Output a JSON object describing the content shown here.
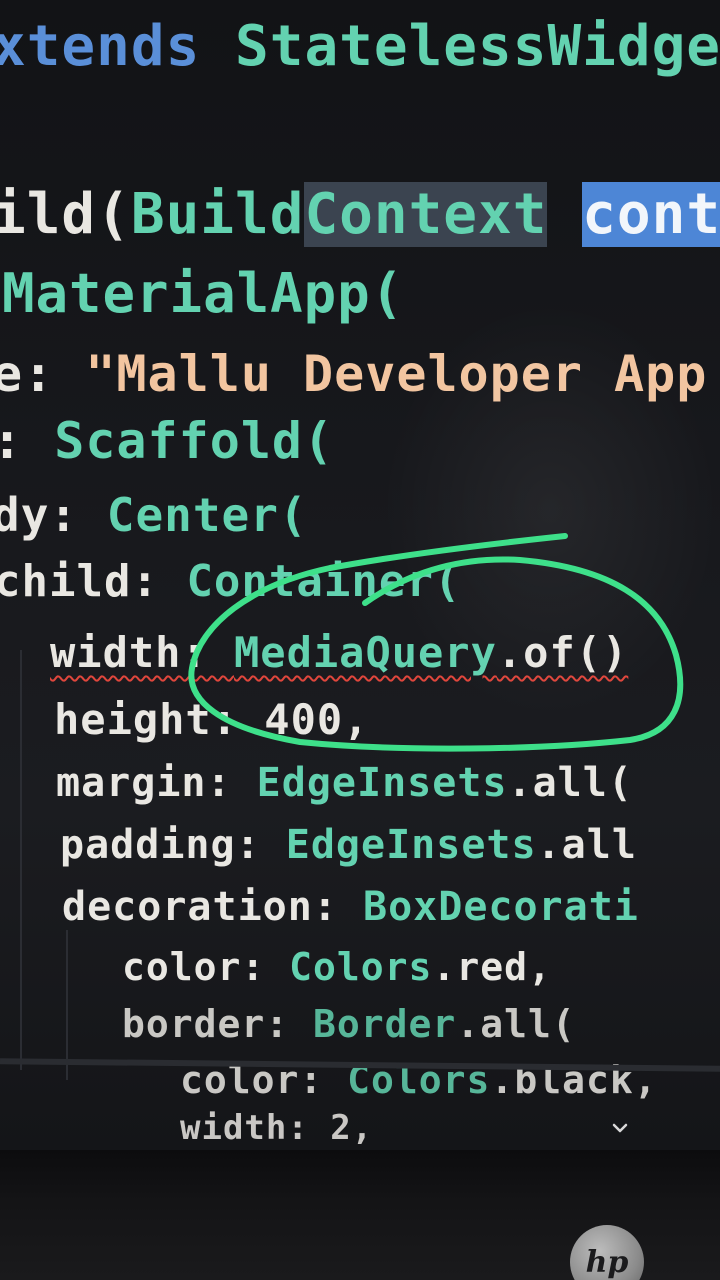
{
  "editor": {
    "lines": [
      {
        "tokens": [
          {
            "text": "xtends ",
            "cls": "k"
          },
          {
            "text": "StatelessWidge",
            "cls": "t"
          }
        ]
      },
      {
        "tokens": [
          {
            "text": "ild(",
            "cls": "p"
          },
          {
            "text": "Build",
            "cls": "t"
          },
          {
            "text": "Context",
            "cls": "t sel-ctx"
          },
          {
            "text": " ",
            "cls": "p"
          },
          {
            "text": "conte",
            "cls": "sel-word"
          }
        ]
      },
      {
        "tokens": [
          {
            "text": "MaterialApp(",
            "cls": "t"
          }
        ]
      },
      {
        "tokens": [
          {
            "text": "e: ",
            "cls": "p"
          },
          {
            "text": "\"Mallu Developer App",
            "cls": "s"
          }
        ]
      },
      {
        "tokens": [
          {
            "text": ": ",
            "cls": "p"
          },
          {
            "text": "Scaffold(",
            "cls": "t"
          }
        ]
      },
      {
        "tokens": [
          {
            "text": "dy: ",
            "cls": "p"
          },
          {
            "text": "Center(",
            "cls": "t"
          }
        ]
      },
      {
        "tokens": [
          {
            "text": "child: ",
            "cls": "p"
          },
          {
            "text": "Container(",
            "cls": "t"
          }
        ]
      },
      {
        "tokens": [
          {
            "text": "width: ",
            "cls": "p squiggle"
          },
          {
            "text": "MediaQuery",
            "cls": "t squiggle"
          },
          {
            "text": ".of()",
            "cls": "p squiggle"
          }
        ]
      },
      {
        "tokens": [
          {
            "text": "height: ",
            "cls": "p"
          },
          {
            "text": "400",
            "cls": "n"
          },
          {
            "text": ",",
            "cls": "p"
          }
        ]
      },
      {
        "tokens": [
          {
            "text": "margin: ",
            "cls": "p"
          },
          {
            "text": "EdgeInsets",
            "cls": "t"
          },
          {
            "text": ".all(",
            "cls": "p"
          }
        ]
      },
      {
        "tokens": [
          {
            "text": "padding: ",
            "cls": "p"
          },
          {
            "text": "EdgeInsets",
            "cls": "t"
          },
          {
            "text": ".all",
            "cls": "p"
          }
        ]
      },
      {
        "tokens": [
          {
            "text": "decoration: ",
            "cls": "p"
          },
          {
            "text": "BoxDecorati",
            "cls": "t"
          }
        ]
      },
      {
        "tokens": [
          {
            "text": "color: ",
            "cls": "p"
          },
          {
            "text": "Colors",
            "cls": "t"
          },
          {
            "text": ".red,",
            "cls": "p"
          }
        ]
      },
      {
        "tokens": [
          {
            "text": "border: ",
            "cls": "p"
          },
          {
            "text": "Border",
            "cls": "t"
          },
          {
            "text": ".all(",
            "cls": "p"
          }
        ]
      },
      {
        "tokens": [
          {
            "text": "color: ",
            "cls": "p"
          },
          {
            "text": "Colors",
            "cls": "t"
          },
          {
            "text": ".black,",
            "cls": "p"
          }
        ]
      },
      {
        "tokens": [
          {
            "text": "width: ",
            "cls": "p"
          },
          {
            "text": "2",
            "cls": "n"
          },
          {
            "text": ",",
            "cls": "p"
          }
        ]
      }
    ]
  },
  "bezel": {
    "logo_text": "hp"
  },
  "colors": {
    "keyword": "#5a8fd8",
    "type": "#63d2b0",
    "string": "#f2c5a0",
    "plain": "#e9e7e2",
    "annotation_stroke": "#3ee08a",
    "error_squiggle": "#e0463c",
    "selection": "#4d86d6"
  },
  "icons": {
    "collapse": "chevron-down-icon",
    "brand": "hp-logo"
  }
}
